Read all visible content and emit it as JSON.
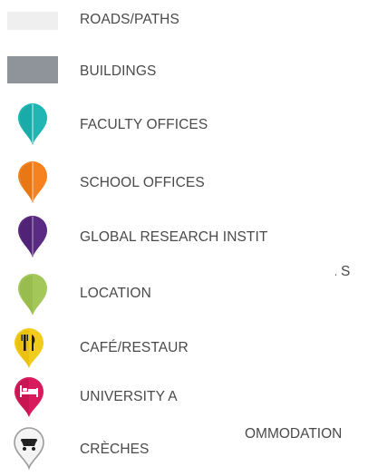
{
  "legend": {
    "items": [
      {
        "key": "roads",
        "label": "ROADS/PATHS",
        "symbol": "swatch",
        "color": "#efefef",
        "icon": "roads-swatch-icon"
      },
      {
        "key": "buildings",
        "label": "BUILDINGS",
        "symbol": "swatch",
        "color": "#8e9499",
        "icon": "buildings-swatch-icon"
      },
      {
        "key": "faculty",
        "label": "FACULTY OFFICES",
        "symbol": "pin",
        "color": "#1fb6b3",
        "icon": "teal-map-pin-icon"
      },
      {
        "key": "school",
        "label": "SCHOOL OFFICES",
        "symbol": "pin",
        "color": "#f5821f",
        "icon": "orange-map-pin-icon"
      },
      {
        "key": "global",
        "label": "GLOBAL RESEARCH INSTIT",
        "symbol": "pin",
        "color": "#5b2a83",
        "icon": "purple-map-pin-icon"
      },
      {
        "key": "location",
        "label": "LOCATION",
        "symbol": "pin",
        "color": "#a4c75a",
        "icon": "green-map-pin-icon"
      },
      {
        "key": "cafe",
        "label": "CAFÉ/RESTAUR",
        "symbol": "pin",
        "color": "#f2cc1c",
        "icon": "fork-knife-pin-icon"
      },
      {
        "key": "accom",
        "label": "UNIVERSITY A",
        "symbol": "pin",
        "color": "#d81b5c",
        "icon": "bed-pin-icon"
      },
      {
        "key": "creches",
        "label": "CRÈCHES",
        "symbol": "pin",
        "color": "#f2f2f2",
        "icon": "pram-pin-icon"
      }
    ],
    "overflow_fragments": [
      {
        "key": "global-tail",
        "text": "S"
      },
      {
        "key": "accom-tail",
        "text": "OMMODATION"
      }
    ]
  }
}
